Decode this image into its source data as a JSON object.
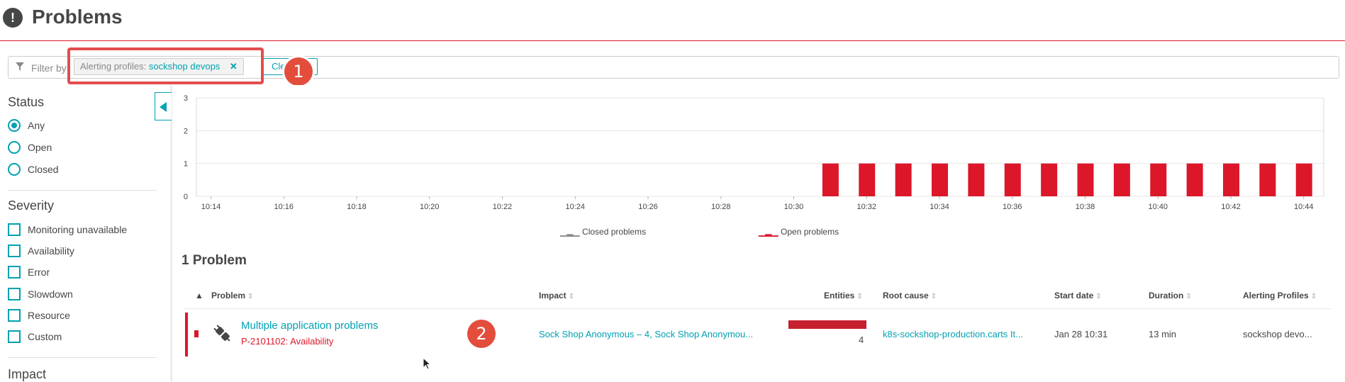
{
  "header": {
    "title": "Problems",
    "logo": "!"
  },
  "filter": {
    "placeholder": "Filter by",
    "chip_key": "Alerting profiles:",
    "chip_value": "sockshop devops",
    "chip_remove": "✕",
    "clear_label": "Clear"
  },
  "annotations": {
    "one": "1",
    "two": "2"
  },
  "sidebar": {
    "status_title": "Status",
    "status_options": [
      {
        "label": "Any",
        "selected": true
      },
      {
        "label": "Open",
        "selected": false
      },
      {
        "label": "Closed",
        "selected": false
      }
    ],
    "severity_title": "Severity",
    "severity_options": [
      {
        "label": "Monitoring unavailable"
      },
      {
        "label": "Availability"
      },
      {
        "label": "Error"
      },
      {
        "label": "Slowdown"
      },
      {
        "label": "Resource"
      },
      {
        "label": "Custom"
      }
    ],
    "impact_title": "Impact"
  },
  "chart_data": {
    "type": "bar",
    "y_ticks": [
      0,
      1,
      2,
      3
    ],
    "ylim": [
      0,
      3
    ],
    "x_ticks": [
      "10:14",
      "10:16",
      "10:18",
      "10:20",
      "10:22",
      "10:24",
      "10:26",
      "10:28",
      "10:30",
      "10:32",
      "10:34",
      "10:36",
      "10:38",
      "10:40",
      "10:42",
      "10:44"
    ],
    "series": [
      {
        "name": "Open problems",
        "color": "#dc172a",
        "times": [
          "10:31",
          "10:32",
          "10:33",
          "10:34",
          "10:35",
          "10:36",
          "10:37",
          "10:38",
          "10:39",
          "10:40",
          "10:41",
          "10:42",
          "10:43",
          "10:44"
        ],
        "values": [
          1,
          1,
          1,
          1,
          1,
          1,
          1,
          1,
          1,
          1,
          1,
          1,
          1,
          1
        ]
      },
      {
        "name": "Closed problems",
        "color": "#898989",
        "times": [],
        "values": []
      }
    ],
    "legend": {
      "closed": "Closed problems",
      "open": "Open problems"
    }
  },
  "problems": {
    "count_label": "1 Problem",
    "columns": {
      "problem": "Problem",
      "impact": "Impact",
      "entities": "Entities",
      "root_cause": "Root cause",
      "start_date": "Start date",
      "duration": "Duration",
      "alerting_profiles": "Alerting Profiles"
    },
    "rows": [
      {
        "title": "Multiple application problems",
        "id": "P-2101102: Availability",
        "impact": "Sock Shop Anonymous –  4, Sock Shop Anonymou...",
        "entities": "4",
        "entities_fill": 1.0,
        "root_cause": "k8s-sockshop-production.carts It...",
        "start_date": "Jan 28 10:31",
        "duration": "13 min",
        "alerting_profiles": "sockshop devo..."
      }
    ]
  }
}
